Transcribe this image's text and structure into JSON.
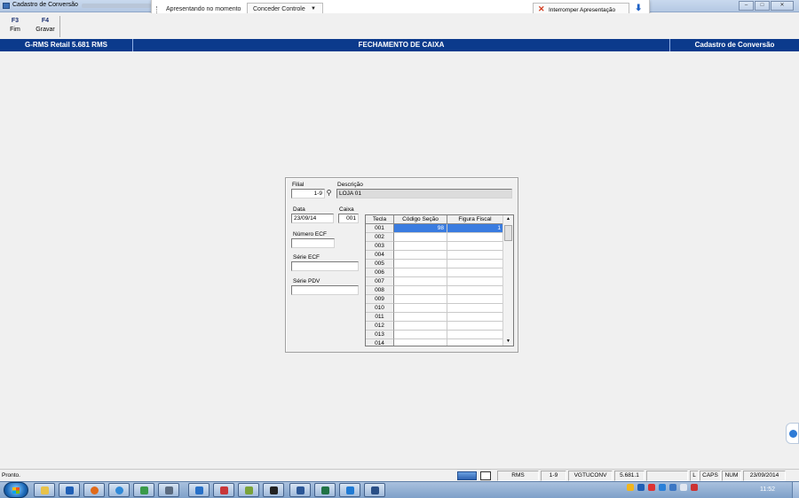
{
  "window": {
    "title": "Cadastro de Conversão",
    "controls": {
      "minimize": "–",
      "maximize": "□",
      "close": "✕"
    }
  },
  "presentation_bar": {
    "presenting_label": "Apresentando no momento",
    "grant_control_label": "Conceder Controle",
    "grant_caret": "▼",
    "stop_label": "Interromper Apresentação",
    "stop_icon": "✕",
    "pin_icon": "⬇"
  },
  "toolbar": {
    "fim": {
      "key": "F3",
      "label": "Fim"
    },
    "gravar": {
      "key": "F4",
      "label": "Gravar"
    }
  },
  "header": {
    "left": "G-RMS Retail 5.681 RMS",
    "center": "FECHAMENTO DE CAIXA",
    "right": "Cadastro de Conversão"
  },
  "form": {
    "filial_label": "Filial",
    "filial_value": "1-9",
    "descricao_label": "Descrição",
    "descricao_value": "LOJA 01",
    "data_label": "Data",
    "data_value": "23/09/14",
    "caixa_label": "Caixa",
    "caixa_value": "001",
    "numero_ecf_label": "Número ECF",
    "numero_ecf_value": "",
    "serie_ecf_label": "Série ECF",
    "serie_ecf_value": "",
    "serie_pdv_label": "Série PDV",
    "serie_pdv_value": ""
  },
  "grid": {
    "columns": [
      "Tecla",
      "Código Seção",
      "Figura Fiscal"
    ],
    "rows": [
      {
        "tecla": "001",
        "codigo": "98",
        "figura": "1"
      },
      {
        "tecla": "002",
        "codigo": "",
        "figura": ""
      },
      {
        "tecla": "003",
        "codigo": "",
        "figura": ""
      },
      {
        "tecla": "004",
        "codigo": "",
        "figura": ""
      },
      {
        "tecla": "005",
        "codigo": "",
        "figura": ""
      },
      {
        "tecla": "006",
        "codigo": "",
        "figura": ""
      },
      {
        "tecla": "007",
        "codigo": "",
        "figura": ""
      },
      {
        "tecla": "008",
        "codigo": "",
        "figura": ""
      },
      {
        "tecla": "009",
        "codigo": "",
        "figura": ""
      },
      {
        "tecla": "010",
        "codigo": "",
        "figura": ""
      },
      {
        "tecla": "011",
        "codigo": "",
        "figura": ""
      },
      {
        "tecla": "012",
        "codigo": "",
        "figura": ""
      },
      {
        "tecla": "013",
        "codigo": "",
        "figura": ""
      },
      {
        "tecla": "014",
        "codigo": "",
        "figura": ""
      }
    ],
    "scroll_up": "▲",
    "scroll_down": "▼"
  },
  "status": {
    "message": "Pronto.",
    "cells": [
      "RMS",
      "1-9",
      "VGTUCONV",
      "5.681.1",
      "",
      "L",
      "CAPS",
      "NUM",
      "23/09/2014"
    ]
  },
  "taskbar": {
    "clock": "11:52",
    "apps": [
      "explorer",
      "outlook",
      "firefox",
      "chrome",
      "media",
      "tool",
      "lync",
      "paint",
      "calc",
      "cmd",
      "word",
      "excel",
      "app",
      "presentation"
    ]
  },
  "colors": {
    "header_bg": "#0b3a8c",
    "selection": "#3a7ce0",
    "stop_icon": "#d23b1e",
    "pin_icon": "#1f62c6"
  }
}
